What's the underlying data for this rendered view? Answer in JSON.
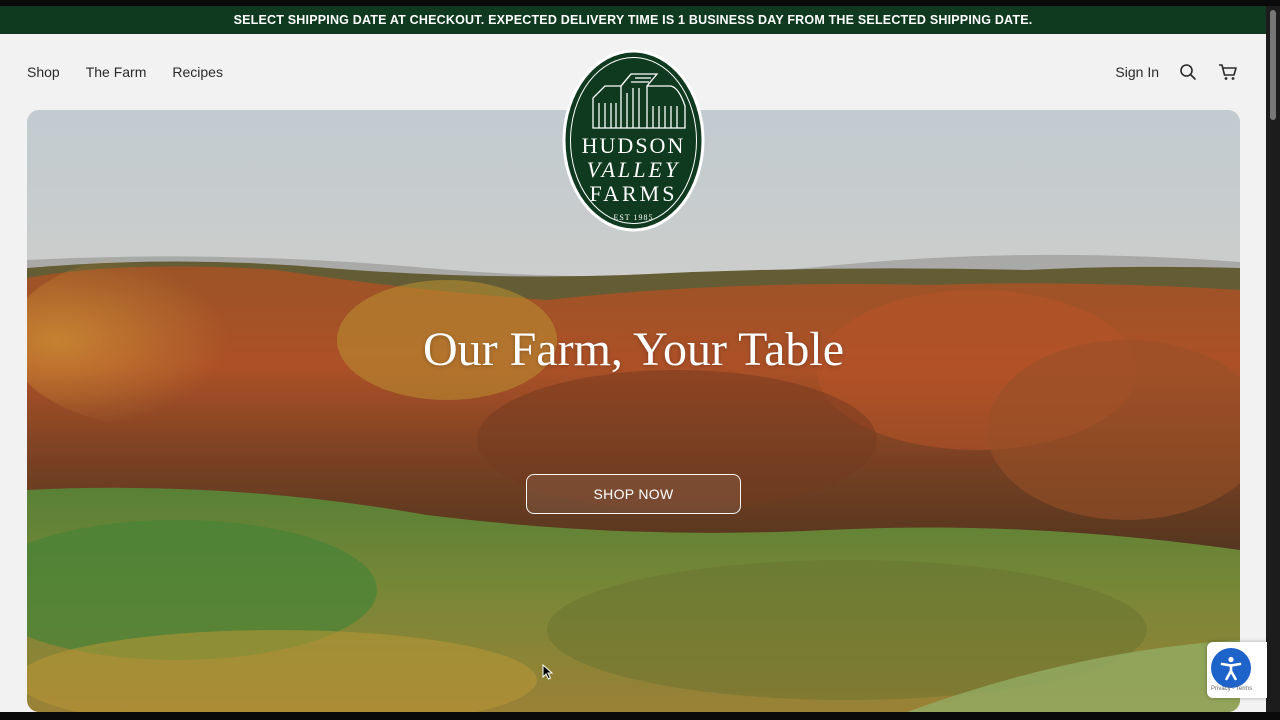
{
  "announcement": {
    "text": "SELECT SHIPPING DATE AT CHECKOUT. EXPECTED DELIVERY TIME IS 1 BUSINESS DAY FROM THE SELECTED SHIPPING DATE."
  },
  "nav": {
    "left": [
      {
        "label": "Shop"
      },
      {
        "label": "The Farm"
      },
      {
        "label": "Recipes"
      }
    ],
    "sign_in": "Sign In",
    "icons": [
      "search-icon",
      "cart-icon"
    ]
  },
  "logo": {
    "line1": "HUDSON",
    "line2": "VALLEY",
    "line3": "FARMS",
    "est": "EST 1985"
  },
  "hero": {
    "title": "Our Farm, Your Table",
    "cta": "SHOP NOW"
  },
  "widget": {
    "recaptcha": "Privacy - Terms"
  },
  "colors": {
    "brand_green": "#0f3a1f",
    "accent_blue": "#1d63c9"
  }
}
